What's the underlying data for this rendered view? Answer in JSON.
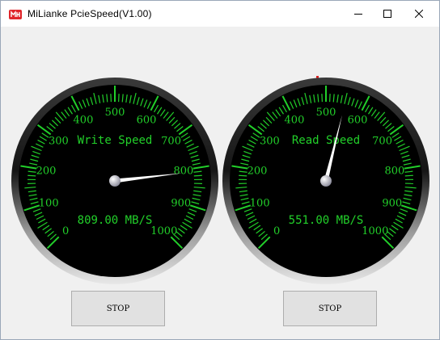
{
  "window": {
    "title": "MiLianke PcieSpeed(V1.00)",
    "icon": "milianke-logo-icon",
    "controls": [
      "minimize-icon",
      "maximize-icon",
      "close-icon"
    ]
  },
  "gauges": [
    {
      "id": "write",
      "title": "Write Speed",
      "readout": "809.00 MB/S",
      "value": 809,
      "min": 0,
      "max": 1000,
      "ticks": [
        "0",
        "100",
        "200",
        "300",
        "400",
        "500",
        "600",
        "700",
        "800",
        "900",
        "1000"
      ],
      "unit": "MB/S",
      "stop_label": "STOP"
    },
    {
      "id": "read",
      "title": "Read Speed",
      "readout": "551.00 MB/S",
      "value": 551,
      "min": 0,
      "max": 1000,
      "ticks": [
        "0",
        "100",
        "200",
        "300",
        "400",
        "500",
        "600",
        "700",
        "800",
        "900",
        "1000"
      ],
      "unit": "MB/S",
      "stop_label": "STOP"
    }
  ],
  "colors": {
    "dial_face": "#000000",
    "scale_text": "#22d02a",
    "needle": "#ffffff",
    "bezel_light": "#e8e8e8",
    "bezel_dark": "#3a3a3a"
  }
}
